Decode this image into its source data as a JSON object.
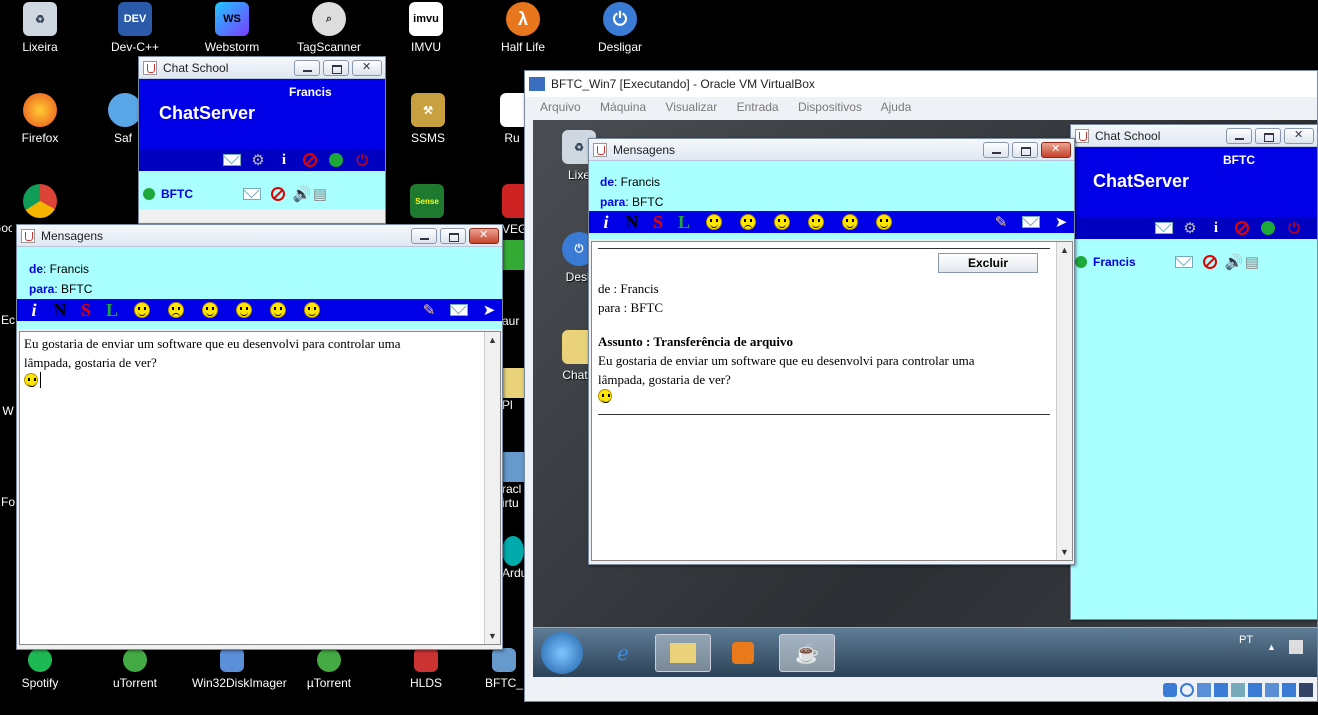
{
  "desktop": {
    "top_icons": [
      "Lixeira",
      "Dev-C++",
      "Webstorm",
      "TagScanner",
      "IMVU",
      "Half Life",
      "Desligar"
    ],
    "left_icons": [
      "Firefox",
      "Saf",
      "SSMS",
      "Ru",
      "Goo",
      "VEGA",
      "Ec",
      "W",
      "Fo"
    ],
    "bottom_icons": [
      "Spotify",
      "uTorrent",
      "Win32DiskImager",
      "µTorrent",
      "HLDS",
      "BFTC_"
    ],
    "mid_icons": [
      "Pl",
      "racl",
      "irtu",
      "Ardu",
      "aur"
    ]
  },
  "chat_server_left": {
    "title": "Chat School",
    "user": "Francis",
    "app_name": "ChatServer",
    "contact": "BFTC"
  },
  "messages_left": {
    "title": "Mensagens",
    "de_label": "de",
    "de_value": ": Francis",
    "para_label": "para",
    "para_value": ": BFTC",
    "format_buttons": [
      "i",
      "N",
      "S",
      "L"
    ],
    "text_line1": "Eu gostaria de enviar um software que eu desenvolvi para controlar uma",
    "text_line2": "lâmpada, gostaria de ver?"
  },
  "vbox": {
    "title": "BFTC_Win7 [Executando] - Oracle VM VirtualBox",
    "menu": [
      "Arquivo",
      "Máquina",
      "Visualizar",
      "Entrada",
      "Dispositivos",
      "Ajuda"
    ],
    "guest_icons": [
      "Lixe",
      "Desli",
      "ChatS"
    ],
    "tray_lang": "PT"
  },
  "messages_right": {
    "title": "Mensagens",
    "de_label": "de",
    "de_value": ": Francis",
    "para_label": "para",
    "para_value": ": BFTC",
    "format_buttons": [
      "i",
      "N",
      "S",
      "L"
    ],
    "delete_button": "Excluir",
    "msg_de": "de : Francis",
    "msg_para": "para : BFTC",
    "subject": "Assunto : Transferência de arquivo",
    "body_line1": "Eu gostaria de enviar um software que eu desenvolvi para controlar uma",
    "body_line2": "lâmpada, gostaria de ver?"
  },
  "chat_server_right": {
    "title": "Chat School",
    "user": "BFTC",
    "app_name": "ChatServer",
    "contact": "Francis"
  },
  "colors": {
    "accent_blue": "#0000e6",
    "panel_cyan": "#aaffff",
    "online_green": "#1ea83a"
  }
}
